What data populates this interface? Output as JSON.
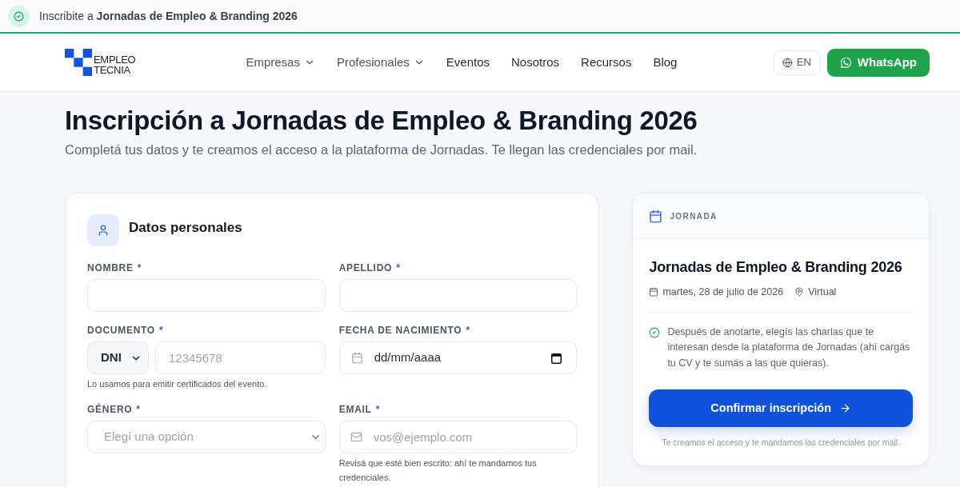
{
  "banner": {
    "text": "Inscribite a **Jornadas de Empleo & Branding 2026**"
  },
  "header": {
    "logo": [
      "EMPLEO",
      "TECNIA"
    ],
    "nav": [
      {
        "label": "Empresas",
        "kind": "dropdown"
      },
      {
        "label": "Profesionales",
        "kind": "dropdown"
      },
      {
        "label": "Eventos",
        "kind": "link"
      },
      {
        "label": "Nosotros",
        "kind": "link"
      },
      {
        "label": "Recursos",
        "kind": "link"
      },
      {
        "label": "Blog",
        "kind": "link"
      }
    ],
    "language_button": "EN",
    "whatsapp_button": "WhatsApp"
  },
  "page": {
    "title": "Inscripción a Jornadas de Empleo & Branding 2026",
    "subtitle": "Completá tus datos y te creamos el acceso a la plataforma de Jornadas. Te llegan las credenciales por mail."
  },
  "form": {
    "section_title": "Datos personales",
    "fields": [
      {
        "kind": "text",
        "label": "NOMBRE",
        "required_mark": "*"
      },
      {
        "kind": "text",
        "label": "APELLIDO",
        "required_mark": "*"
      },
      {
        "kind": "document",
        "label": "DOCUMENTO",
        "required_mark": "*",
        "document_type": "DNI",
        "placeholder": "12345678",
        "hint": "Lo usamos para emitir certificados del evento."
      },
      {
        "kind": "date",
        "label": "FECHA DE NACIMIENTO",
        "required_mark": "*",
        "value": "dd/mm/aaaa"
      },
      {
        "kind": "select",
        "label": "GÉNERO",
        "required_mark": "*",
        "placeholder": "Elegí una opción"
      },
      {
        "kind": "email",
        "label": "EMAIL",
        "required_mark": "*",
        "placeholder": "vos@ejemplo.com",
        "hint": "Revisá que esté bien escrito: ahí te mandamos tus credenciales."
      }
    ]
  },
  "event_card": {
    "label": "JORNADA",
    "title": "Jornadas de Empleo & Branding 2026",
    "date": "martes, 28 de julio de 2026",
    "location": "Virtual",
    "note": "Después de anotarte, elegís las charlas que te interesan desde la plataforma de Jornadas (ahí cargás tu CV y te sumás a las que quieras).",
    "button": "Confirmar inscripción",
    "footnote": "Te creamos el acceso y te mandamos las credenciales por mail."
  }
}
